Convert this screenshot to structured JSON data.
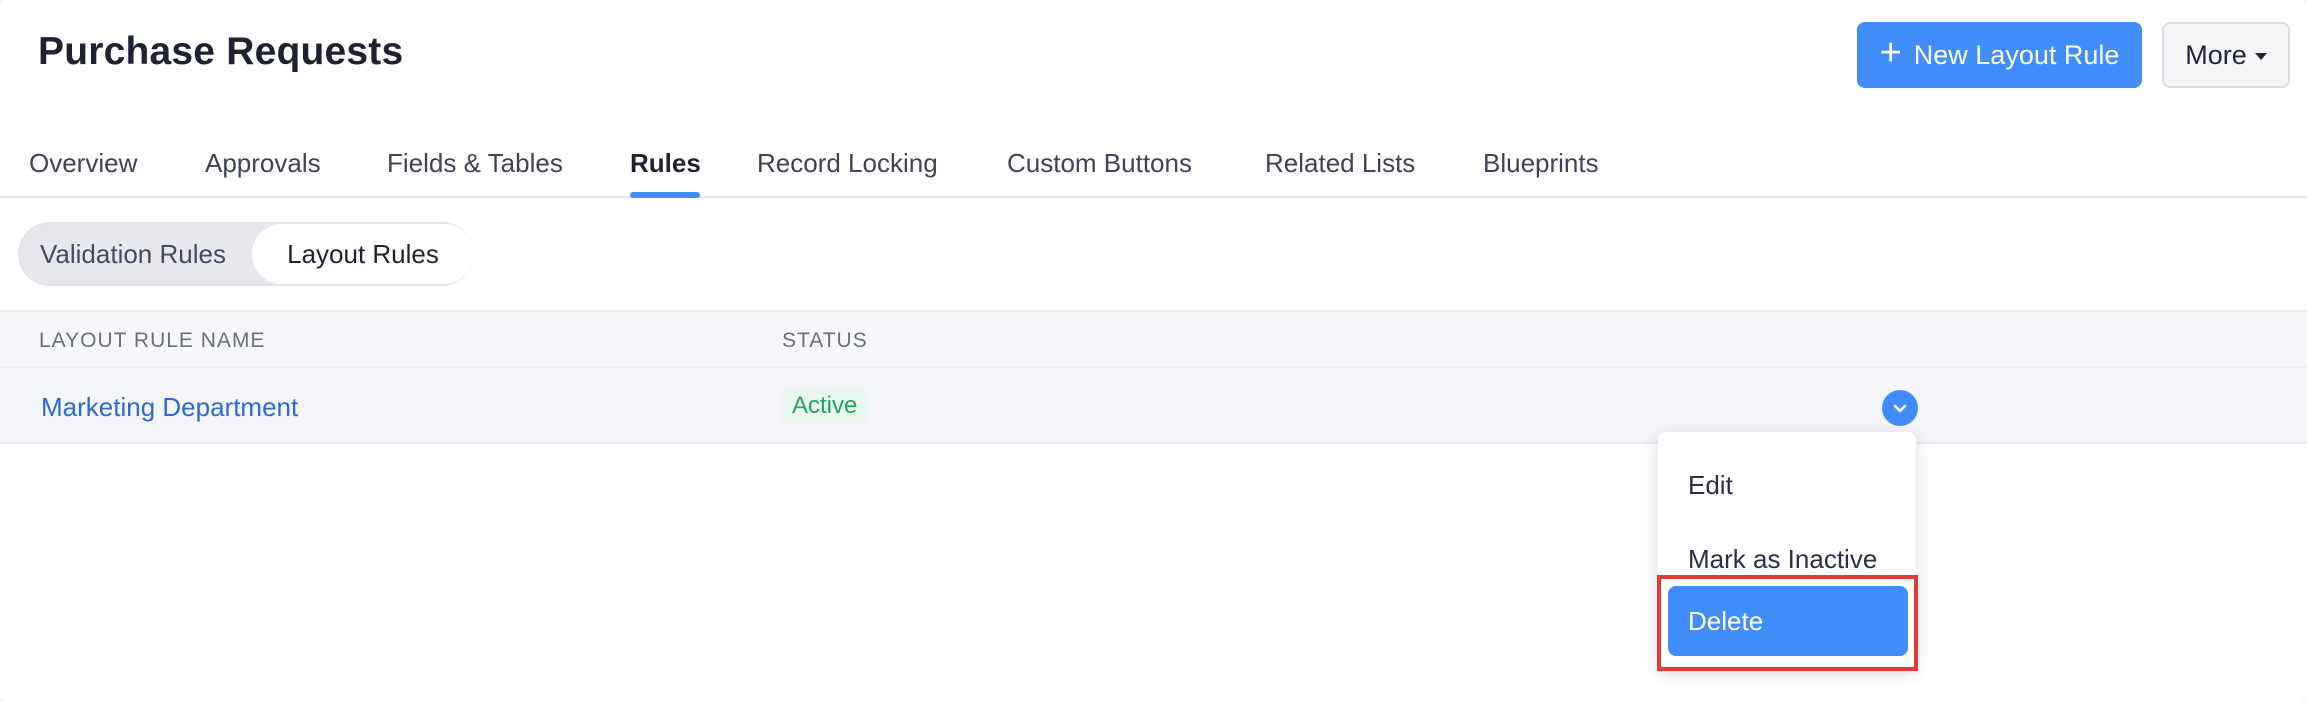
{
  "header": {
    "title": "Purchase Requests",
    "new_button_label": "New Layout Rule",
    "more_button_label": "More"
  },
  "tabs": [
    {
      "label": "Overview",
      "active": false
    },
    {
      "label": "Approvals",
      "active": false
    },
    {
      "label": "Fields & Tables",
      "active": false
    },
    {
      "label": "Rules",
      "active": true
    },
    {
      "label": "Record Locking",
      "active": false
    },
    {
      "label": "Custom Buttons",
      "active": false
    },
    {
      "label": "Related Lists",
      "active": false
    },
    {
      "label": "Blueprints",
      "active": false
    }
  ],
  "subtabs": {
    "validation_label": "Validation Rules",
    "layout_label": "Layout Rules",
    "selected": "Layout Rules"
  },
  "table": {
    "columns": [
      "LAYOUT RULE NAME",
      "STATUS"
    ],
    "rows": [
      {
        "name": "Marketing Department",
        "status": "Active"
      }
    ]
  },
  "row_menu": {
    "items": [
      "Edit",
      "Mark as Inactive",
      "Delete"
    ],
    "highlighted": "Delete"
  },
  "colors": {
    "accent": "#408dfb",
    "link": "#2a6ad8",
    "status_active": "#21a65a",
    "highlight_border": "#e53935"
  }
}
